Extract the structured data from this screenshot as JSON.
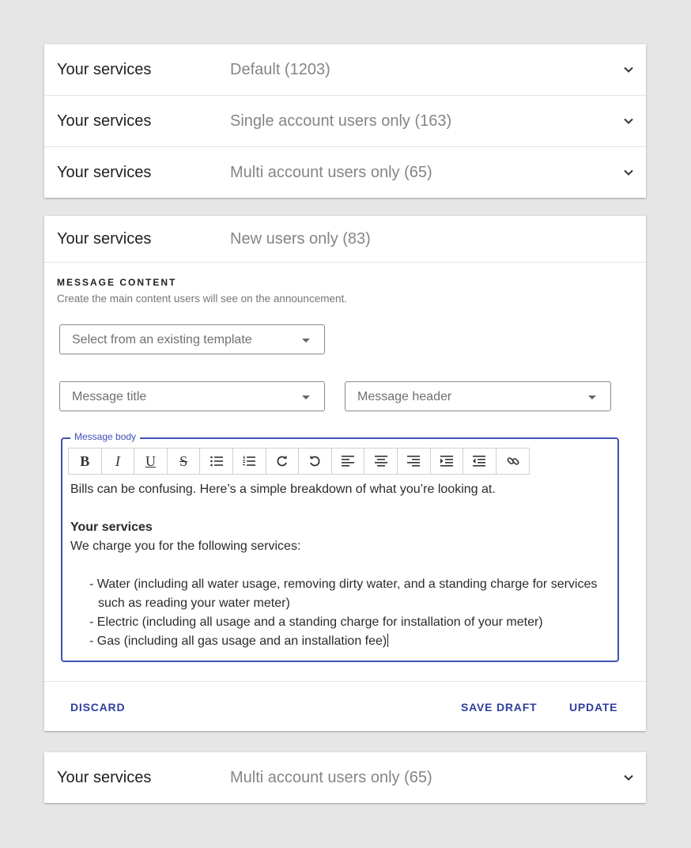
{
  "top_group": {
    "rows": [
      {
        "title": "Your services",
        "subtitle": "Default (1203)"
      },
      {
        "title": "Your services",
        "subtitle": "Single account users only (163)"
      },
      {
        "title": "Your services",
        "subtitle": "Multi account users only (65)"
      }
    ]
  },
  "expanded": {
    "title": "Your services",
    "subtitle": "New users only (83)",
    "section_label": "MESSAGE CONTENT",
    "section_desc": "Create the main content users will see on the announcement.",
    "template_select": {
      "placeholder": "Select from an existing template"
    },
    "title_select": {
      "placeholder": "Message title"
    },
    "header_select": {
      "placeholder": "Message header"
    },
    "editor": {
      "legend": "Message body",
      "toolbar": [
        {
          "label": "B",
          "icon": "bold-icon"
        },
        {
          "label": "I",
          "icon": "italic-icon"
        },
        {
          "label": "U",
          "icon": "underline-icon"
        },
        {
          "label": "S",
          "icon": "strikethrough-icon"
        },
        {
          "label": "",
          "icon": "bulleted-list-icon"
        },
        {
          "label": "",
          "icon": "numbered-list-icon"
        },
        {
          "label": "",
          "icon": "redo-icon"
        },
        {
          "label": "",
          "icon": "undo-icon"
        },
        {
          "label": "",
          "icon": "align-left-icon"
        },
        {
          "label": "",
          "icon": "align-center-icon"
        },
        {
          "label": "",
          "icon": "align-right-icon"
        },
        {
          "label": "",
          "icon": "indent-icon"
        },
        {
          "label": "",
          "icon": "outdent-icon"
        },
        {
          "label": "",
          "icon": "link-icon"
        }
      ],
      "intro": "Bills can be confusing. Here’s a simple breakdown of what you’re looking at.",
      "heading": "Your services",
      "lead": "We charge you for the following services:",
      "bullets": [
        "- Water (including all water usage, removing dirty water, and a standing charge for services such as reading your water meter)",
        "- Electric (including all usage and a standing charge for installation of your meter)",
        "- Gas (including all gas usage and an installation fee)"
      ]
    },
    "actions": {
      "discard": "DISCARD",
      "save_draft": "SAVE DRAFT",
      "update": "UPDATE"
    }
  },
  "bottom_group": {
    "rows": [
      {
        "title": "Your services",
        "subtitle": "Multi account users only (65)"
      }
    ]
  },
  "colors": {
    "accent": "#3f51b5",
    "button_text": "#2f3e9e",
    "background": "#e6e6e6"
  }
}
